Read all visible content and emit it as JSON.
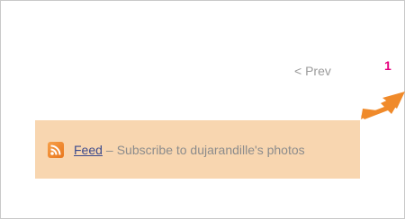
{
  "pagination": {
    "prev_label": "< Prev"
  },
  "callout": {
    "number": "1",
    "number_color": "#e6007e",
    "arrow_color": "#f08a2a"
  },
  "feed_box": {
    "background": "#f8d6b0",
    "icon": "rss-feed-icon",
    "link_label": "Feed",
    "separator": "–",
    "description": "Subscribe to dujarandille's photos"
  }
}
